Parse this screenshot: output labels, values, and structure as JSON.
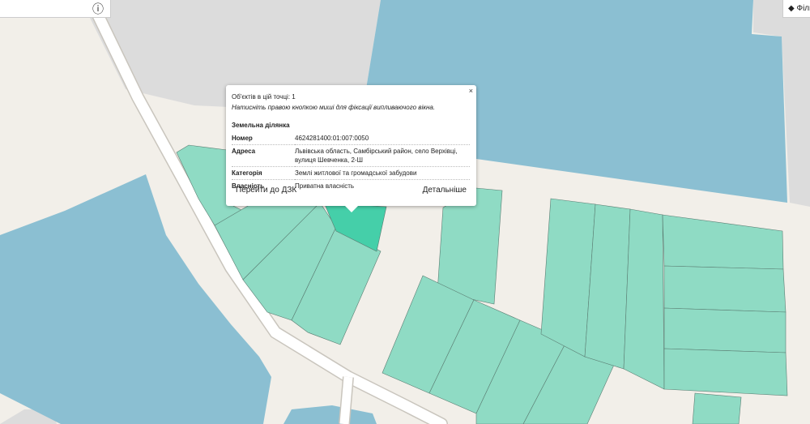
{
  "toolbar": {
    "info_icon_glyph": "ⓘ",
    "filter_label": "Філь"
  },
  "popup": {
    "close_glyph": "×",
    "objects_count_text": "Об'єктів в цій точці: 1",
    "hint_text": "Натисніть правою кнопкою миші для фіксації випливаючого вікна.",
    "section_title": "Земельна ділянка",
    "rows": [
      {
        "key": "Номер",
        "value": "4624281400:01:007:0050"
      },
      {
        "key": "Адреса",
        "value": "Львівська область, Самбірський район, село Верхівці, вулиця Шевченка, 2-Ш"
      },
      {
        "key": "Категорія",
        "value": "Землі житлової та громадської забудови"
      },
      {
        "key": "Власність",
        "value": "Приватна власність"
      }
    ],
    "go_to_dzk_label": "Перейти до ДЗК",
    "details_label": "Детальніше"
  },
  "colors": {
    "background": "#f2efe9",
    "water": "#8bbfd2",
    "industrial": "#dcdcdc",
    "parcel": "#8fdbc4",
    "parcel_selected": "#45cfa9",
    "road": "#ffffff"
  }
}
